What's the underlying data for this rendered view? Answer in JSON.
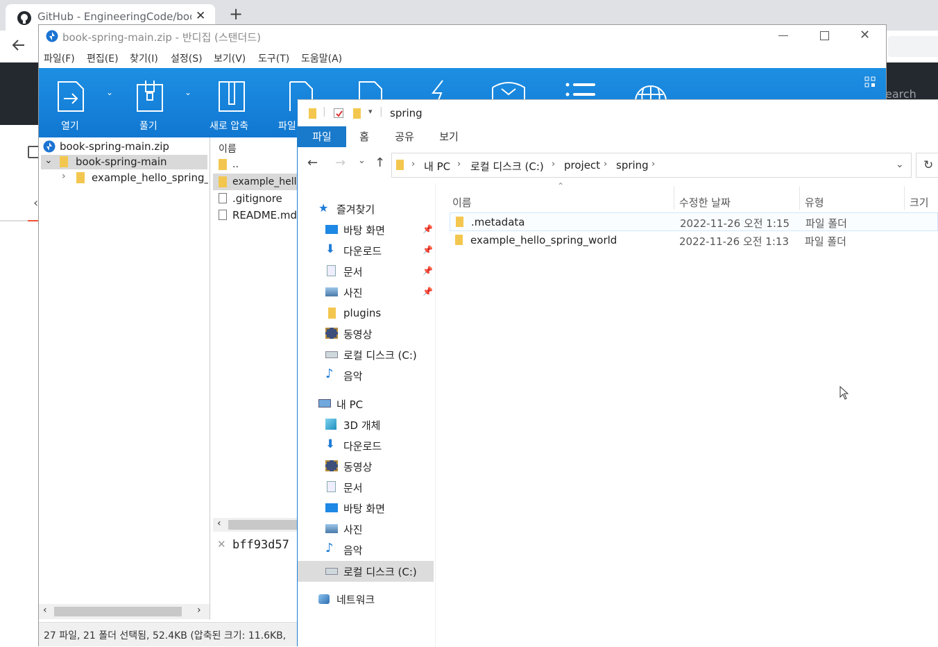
{
  "browser": {
    "tab_title": "GitHub - EngineeringCode/book",
    "new_tab_label": "+",
    "close_label": "✕",
    "search_placeholder": "earch"
  },
  "bandizip": {
    "title": "book-spring-main.zip - 반디집 (스탠더드)",
    "menu": [
      "파일(F)",
      "편집(E)",
      "찾기(I)",
      "설정(S)",
      "보기(V)",
      "도구(T)",
      "도움말(A)"
    ],
    "ribbon": {
      "open": "열기",
      "extract": "풀기",
      "new_archive": "새로 압축",
      "file_partial": "파일"
    },
    "tree": {
      "root": "book-spring-main.zip",
      "folder": "book-spring-main",
      "child": "example_hello_spring_wo"
    },
    "list": {
      "header": "이름",
      "items": [
        "..",
        "example_hello",
        ".gitignore",
        "README.md"
      ]
    },
    "hash_text": "bff93d57",
    "status": "27 파일, 21 폴더 선택됨, 52.4KB (압축된 크기: 11.6KB,"
  },
  "explorer": {
    "title": "spring",
    "ribbon_tabs": [
      "파일",
      "홈",
      "공유",
      "보기"
    ],
    "breadcrumb": [
      "내 PC",
      "로컬 디스크 (C:)",
      "project",
      "spring"
    ],
    "nav": {
      "quick_access": "즐겨찾기",
      "quick_items": [
        "바탕 화면",
        "다운로드",
        "문서",
        "사진",
        "plugins",
        "동영상",
        "로컬 디스크 (C:)",
        "음악"
      ],
      "this_pc": "내 PC",
      "pc_items": [
        "3D 개체",
        "다운로드",
        "동영상",
        "문서",
        "바탕 화면",
        "사진",
        "음악",
        "로컬 디스크 (C:)"
      ],
      "network": "네트워크"
    },
    "columns": [
      "이름",
      "수정한 날짜",
      "유형",
      "크기"
    ],
    "files": [
      {
        "name": ".metadata",
        "date": "2022-11-26 오전 1:15",
        "type": "파일 폴더"
      },
      {
        "name": "example_hello_spring_world",
        "date": "2022-11-26 오전 1:13",
        "type": "파일 폴더"
      }
    ]
  },
  "colors": {
    "bandizip_ribbon": "#1a86dd",
    "explorer_accent": "#1979ca",
    "folder": "#f3c74f",
    "github_header": "#24292f"
  }
}
